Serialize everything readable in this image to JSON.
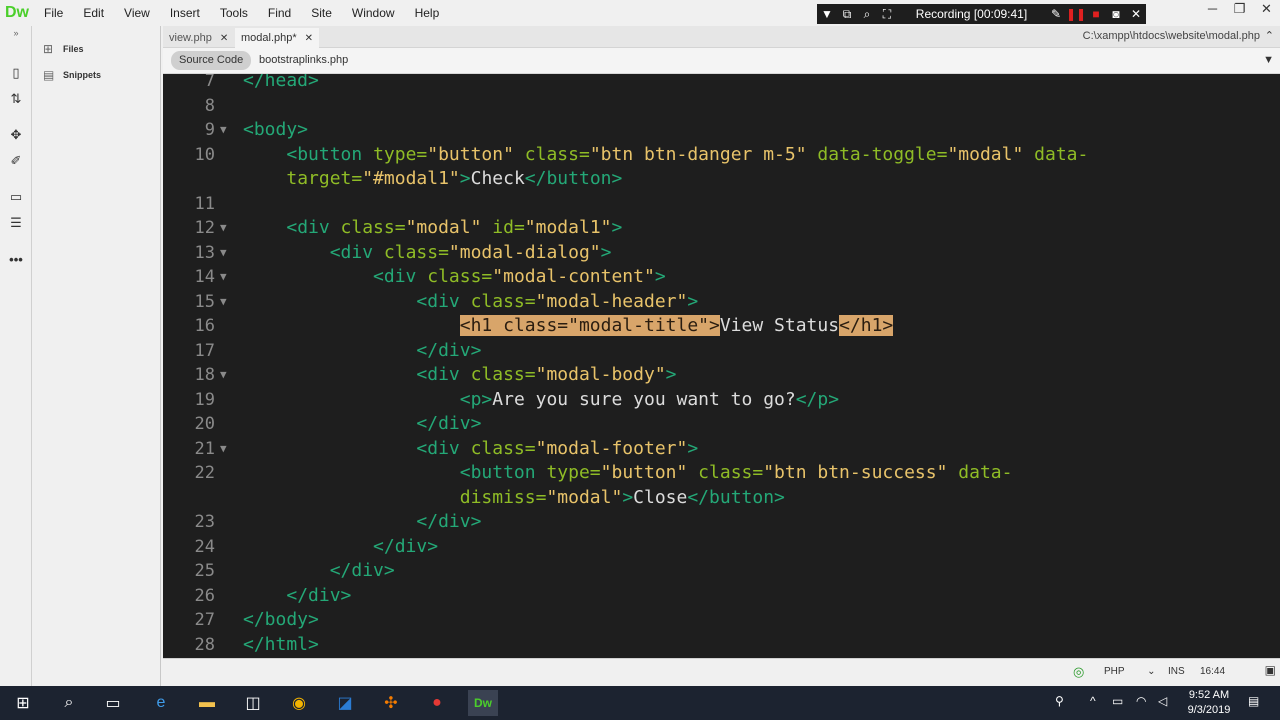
{
  "app": {
    "logo": "Dw",
    "menu": [
      "File",
      "Edit",
      "View",
      "Insert",
      "Tools",
      "Find",
      "Site",
      "Window",
      "Help"
    ]
  },
  "recorder": {
    "status": "Recording [00:09:41]"
  },
  "side_panel": {
    "items": [
      {
        "label": "Files",
        "icon": "files-icon"
      },
      {
        "label": "Snippets",
        "icon": "snippets-icon"
      }
    ]
  },
  "tabs": [
    {
      "label": "view.php",
      "active": false
    },
    {
      "label": "modal.php*",
      "active": true
    }
  ],
  "file_path": "C:\\xampp\\htdocs\\website\\modal.php",
  "related_files": [
    {
      "label": "Source Code",
      "selected": true
    },
    {
      "label": "bootstraplinks.php",
      "selected": false
    }
  ],
  "code": {
    "lines": [
      {
        "n": "7",
        "fold": "",
        "indent": "",
        "tokens": [
          [
            "tag",
            "</head>"
          ]
        ]
      },
      {
        "n": "8",
        "fold": "",
        "indent": "",
        "tokens": []
      },
      {
        "n": "9",
        "fold": "▼",
        "indent": "",
        "tokens": [
          [
            "tag",
            "<body>"
          ]
        ]
      },
      {
        "n": "10",
        "fold": "",
        "indent": "    ",
        "tokens": [
          [
            "tag",
            "<button "
          ],
          [
            "attr",
            "type="
          ],
          [
            "str",
            "\"button\""
          ],
          [
            "attr",
            " class="
          ],
          [
            "str",
            "\"btn btn-danger m-5\""
          ],
          [
            "attr",
            " data-toggle="
          ],
          [
            "str",
            "\"modal\""
          ],
          [
            "attr",
            " data-"
          ]
        ]
      },
      {
        "n": "",
        "fold": "",
        "indent": "    ",
        "tokens": [
          [
            "attr",
            "target="
          ],
          [
            "str",
            "\"#modal1\""
          ],
          [
            "tag",
            ">"
          ],
          [
            "txt",
            "Check"
          ],
          [
            "tag",
            "</button>"
          ]
        ]
      },
      {
        "n": "11",
        "fold": "",
        "indent": "",
        "tokens": []
      },
      {
        "n": "12",
        "fold": "▼",
        "indent": "    ",
        "tokens": [
          [
            "tag",
            "<div "
          ],
          [
            "attr",
            "class="
          ],
          [
            "str",
            "\"modal\""
          ],
          [
            "attr",
            " id="
          ],
          [
            "str",
            "\"modal1\""
          ],
          [
            "tag",
            ">"
          ]
        ]
      },
      {
        "n": "13",
        "fold": "▼",
        "indent": "        ",
        "tokens": [
          [
            "tag",
            "<div "
          ],
          [
            "attr",
            "class="
          ],
          [
            "str",
            "\"modal-dialog\""
          ],
          [
            "tag",
            ">"
          ]
        ]
      },
      {
        "n": "14",
        "fold": "▼",
        "indent": "            ",
        "tokens": [
          [
            "tag",
            "<div "
          ],
          [
            "attr",
            "class="
          ],
          [
            "str",
            "\"modal-content\""
          ],
          [
            "tag",
            ">"
          ]
        ]
      },
      {
        "n": "15",
        "fold": "▼",
        "indent": "                ",
        "tokens": [
          [
            "tag",
            "<div "
          ],
          [
            "attr",
            "class="
          ],
          [
            "str",
            "\"modal-header\""
          ],
          [
            "tag",
            ">"
          ]
        ]
      },
      {
        "n": "16",
        "fold": "",
        "indent": "                    ",
        "tokens": [
          [
            "hl",
            "<h1 class=\"modal-title\">"
          ],
          [
            "txt",
            "View Status"
          ],
          [
            "hl",
            "</h1>"
          ]
        ]
      },
      {
        "n": "17",
        "fold": "",
        "indent": "                ",
        "tokens": [
          [
            "tag",
            "</div>"
          ]
        ]
      },
      {
        "n": "18",
        "fold": "▼",
        "indent": "                ",
        "tokens": [
          [
            "tag",
            "<div "
          ],
          [
            "attr",
            "class="
          ],
          [
            "str",
            "\"modal-body\""
          ],
          [
            "tag",
            ">"
          ]
        ]
      },
      {
        "n": "19",
        "fold": "",
        "indent": "                    ",
        "tokens": [
          [
            "tag",
            "<p>"
          ],
          [
            "txt",
            "Are you sure you want to go?"
          ],
          [
            "tag",
            "</p>"
          ]
        ]
      },
      {
        "n": "20",
        "fold": "",
        "indent": "                ",
        "tokens": [
          [
            "tag",
            "</div>"
          ]
        ]
      },
      {
        "n": "21",
        "fold": "▼",
        "indent": "                ",
        "tokens": [
          [
            "tag",
            "<div "
          ],
          [
            "attr",
            "class="
          ],
          [
            "str",
            "\"modal-footer\""
          ],
          [
            "tag",
            ">"
          ]
        ]
      },
      {
        "n": "22",
        "fold": "",
        "indent": "                    ",
        "tokens": [
          [
            "tag",
            "<button "
          ],
          [
            "attr",
            "type="
          ],
          [
            "str",
            "\"button\""
          ],
          [
            "attr",
            " class="
          ],
          [
            "str",
            "\"btn btn-success\""
          ],
          [
            "attr",
            " data-"
          ]
        ]
      },
      {
        "n": "",
        "fold": "",
        "indent": "                    ",
        "tokens": [
          [
            "attr",
            "dismiss="
          ],
          [
            "str",
            "\"modal\""
          ],
          [
            "tag",
            ">"
          ],
          [
            "txt",
            "Close"
          ],
          [
            "tag",
            "</button>"
          ]
        ]
      },
      {
        "n": "23",
        "fold": "",
        "indent": "                ",
        "tokens": [
          [
            "tag",
            "</div>"
          ]
        ]
      },
      {
        "n": "24",
        "fold": "",
        "indent": "            ",
        "tokens": [
          [
            "tag",
            "</div>"
          ]
        ]
      },
      {
        "n": "25",
        "fold": "",
        "indent": "        ",
        "tokens": [
          [
            "tag",
            "</div>"
          ]
        ]
      },
      {
        "n": "26",
        "fold": "",
        "indent": "    ",
        "tokens": [
          [
            "tag",
            "</div>"
          ]
        ]
      },
      {
        "n": "27",
        "fold": "",
        "indent": "",
        "tokens": [
          [
            "tag",
            "</body>"
          ]
        ]
      },
      {
        "n": "28",
        "fold": "",
        "indent": "",
        "tokens": [
          [
            "tag",
            "</html>"
          ]
        ]
      }
    ]
  },
  "status": {
    "language": "PHP",
    "mode": "INS",
    "position": "16:44"
  },
  "taskbar": {
    "time": "9:52 AM",
    "date": "9/3/2019"
  }
}
